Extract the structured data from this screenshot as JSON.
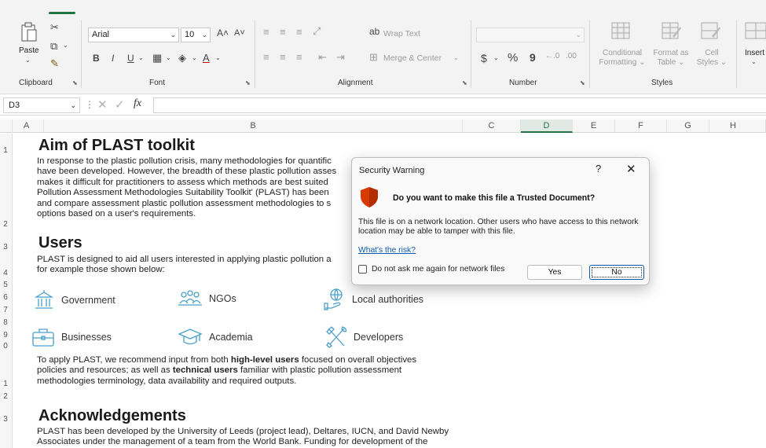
{
  "ribbon": {
    "clipboard": {
      "label": "Clipboard",
      "paste_label": "Paste"
    },
    "font": {
      "label": "Font",
      "font_name": "Arial",
      "font_size": "10"
    },
    "alignment": {
      "label": "Alignment",
      "wrap_text": "Wrap Text",
      "merge_center": "Merge & Center"
    },
    "number": {
      "label": "Number",
      "percent_symbol": "%",
      "comma_symbol": "9",
      "currency_symbol": "$"
    },
    "styles": {
      "label": "Styles",
      "conditional_line1": "Conditional",
      "conditional_line2": "Formatting",
      "format_table_line1": "Format as",
      "format_table_line2": "Table",
      "cell_styles_line1": "Cell",
      "cell_styles_line2": "Styles"
    },
    "cells": {
      "insert_label": "Insert"
    }
  },
  "formula_bar": {
    "name_box": "D3",
    "fx_label": "fx",
    "content": ""
  },
  "grid": {
    "columns": [
      "A",
      "B",
      "C",
      "D",
      "E",
      "F",
      "G",
      "H"
    ],
    "selected_column": "D",
    "rows": [
      "1",
      "2",
      "3",
      "4",
      "5",
      "6",
      "7",
      "8",
      "9",
      "0",
      "1",
      "2",
      "3"
    ]
  },
  "sheet": {
    "aim_title": "Aim of PLAST toolkit",
    "aim_lines": [
      "In response to the plastic pollution crisis, many methodologies for quantific",
      "have been developed. However, the breadth of these plastic pollution asses",
      "makes it difficult for practitioners to assess which methods are best suited",
      "Pollution Assessment Methodologies Suitability Toolkit' (PLAST) has been",
      "and compare assessment plastic pollution assessment methodologies to s",
      "options based on a user's requirements."
    ],
    "users_title": "Users",
    "users_lines": [
      "PLAST is designed to aid all users interested in applying plastic pollution a",
      "for example those shown below:"
    ],
    "user_types": {
      "government": "Government",
      "ngos": "NGOs",
      "local_authorities": "Local authorities",
      "businesses": "Businesses",
      "academia": "Academia",
      "developers": "Developers"
    },
    "apply": {
      "line1_pre": "To apply PLAST, we recommend input from both ",
      "line1_bold": "high-level users",
      "line1_post": " focused on overall objectives",
      "line2_pre": "policies and resources; as well as ",
      "line2_bold": "technical users",
      "line2_post": " familiar with plastic pollution assessment",
      "line3": "methodologies terminology, data availability and required outputs."
    },
    "ack_title": "Acknowledgements",
    "ack_lines": [
      "PLAST has been developed by the University of Leeds (project lead), Deltares, IUCN, and David Newby",
      "Associates under the management of a team from the World Bank. Funding for development of the"
    ]
  },
  "dialog": {
    "title": "Security Warning",
    "help": "?",
    "close": "✕",
    "question": "Do you want to make this file a Trusted Document?",
    "message": "This file is on a network location. Other users who have access to this network location may be able to tamper with this file.",
    "link": "What's the risk?",
    "checkbox_label": "Do not ask me again for network files",
    "yes_label": "Yes",
    "no_label": "No"
  },
  "colors": {
    "accent": "#217346",
    "link": "#0b5cad",
    "shield": "#d83b01"
  }
}
